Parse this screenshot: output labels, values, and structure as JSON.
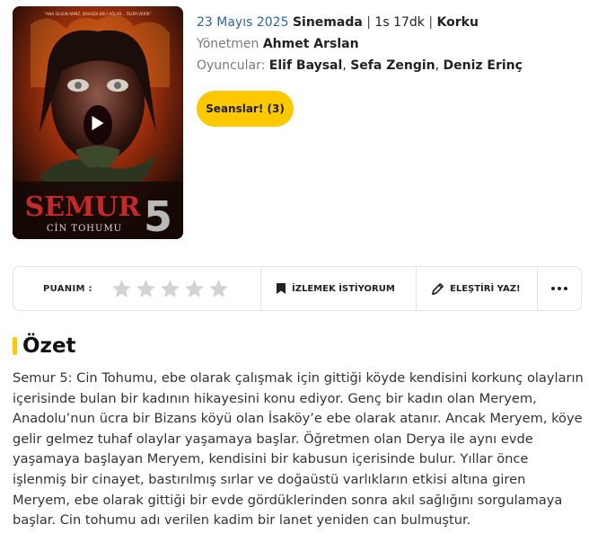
{
  "poster": {
    "tagline": "\"ANA OLSUN KİMİZ, DAVUDA BELİ AĞLAR... ÖLÜM VERİR\"",
    "title_art": "SEMUR",
    "number_art": "5",
    "subtitle_art": "CİN TOHUMU"
  },
  "meta": {
    "date": "23 Mayıs 2025",
    "status": "Sinemada",
    "sep1": " | ",
    "duration": "1s 17dk",
    "sep2": " | ",
    "genre": "Korku",
    "director_label": "Yönetmen",
    "director": "Ahmet Arslan",
    "cast_label": "Oyuncular:",
    "cast": [
      "Elif Baysal",
      "Sefa Zengin",
      "Deniz Erinç"
    ],
    "comma": ", "
  },
  "sessions_button": "Seanslar! (3)",
  "actions": {
    "rating_label": "PUANIM :",
    "rating_value": 0,
    "rating_max": 5,
    "watchlist": "İZLEMEK İSTİYORUM",
    "review": "ELEŞTİRİ YAZ!"
  },
  "summary": {
    "heading": "Özet",
    "text": "Semur 5: Cin Tohumu, ebe olarak çalışmak için gittiği köyde kendisini korkunç olayların içerisinde bulan bir kadının hikayesini konu ediyor. Genç bir kadın olan Meryem, Anadolu’nun ücra bir Bizans köyü olan İsaköy’e ebe olarak atanır. Ancak Meryem, köye gelir gelmez tuhaf olaylar yaşamaya başlar. Öğretmen olan Derya ile aynı evde yaşamaya başlayan Meryem, kendisini bir kabusun içerisinde bulur. Yıllar önce işlenmiş bir cinayet, bastırılmış sırlar ve doğaüstü varlıkların etkisi altına giren Meryem, ebe olarak gittiği bir evde gördüklerinden sonra akıl sağlığını sorgulamaya başlar. Cin tohumu adı verilen kadim bir lanet yeniden can bulmuştur."
  },
  "colors": {
    "accent": "#fcc800",
    "date_blue": "#2a66a4",
    "star_empty": "#d3d3d3"
  }
}
